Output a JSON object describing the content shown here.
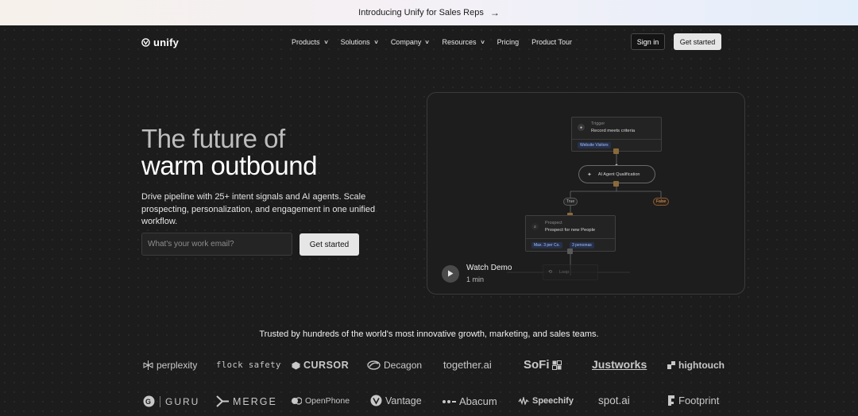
{
  "banner": {
    "text_prefix": "Introducing Unify for ",
    "text_emph": "Sales Reps",
    "arrow": "→"
  },
  "nav": {
    "brand": "unify",
    "items": [
      {
        "label": "Products",
        "has_dropdown": true
      },
      {
        "label": "Solutions",
        "has_dropdown": true
      },
      {
        "label": "Company",
        "has_dropdown": true
      },
      {
        "label": "Resources",
        "has_dropdown": true
      },
      {
        "label": "Pricing",
        "has_dropdown": false
      },
      {
        "label": "Product Tour",
        "has_dropdown": false
      }
    ],
    "sign_in": "Sign in",
    "get_started": "Get started"
  },
  "hero": {
    "title_line1": "The future of",
    "title_line2": "warm outbound",
    "description": "Drive pipeline with 25+ intent signals and AI agents. Scale prospecting, personalization, and engagement in one unified workflow.",
    "email_placeholder": "What's your work email?",
    "cta": "Get started"
  },
  "demo": {
    "trigger_label": "Trigger",
    "trigger_value": "Record meets criteria",
    "trigger_chip": "Website Visitors",
    "agent_label": "AI Agent Qualification",
    "true_label": "True",
    "false_label": "False",
    "prospect_label": "Prospect",
    "prospect_value": "Prospect for new People",
    "chip_left": "Max. 3 per Co.",
    "chip_right": "3 personas",
    "loop_label": "Loop",
    "watch_title": "Watch Demo",
    "watch_duration": "1 min"
  },
  "trusted": {
    "text": "Trusted by hundreds of the world's most innovative growth, marketing, and sales teams.",
    "logos_row1": [
      "perplexity",
      "flock safety",
      "CURSOR",
      "Decagon",
      "together.ai",
      "SoFi",
      "Justworks",
      "hightouch"
    ],
    "logos_row2": [
      "GURU",
      "MERGE",
      "OpenPhone",
      "Vantage",
      "Abacum",
      "Speechify",
      "spot.ai",
      "Footprint"
    ]
  },
  "colors": {
    "background": "#1c1c1c",
    "button_light": "#e6e6e6",
    "chip_blue": "#a9c1ff",
    "false_orange": "#e8a26a"
  }
}
